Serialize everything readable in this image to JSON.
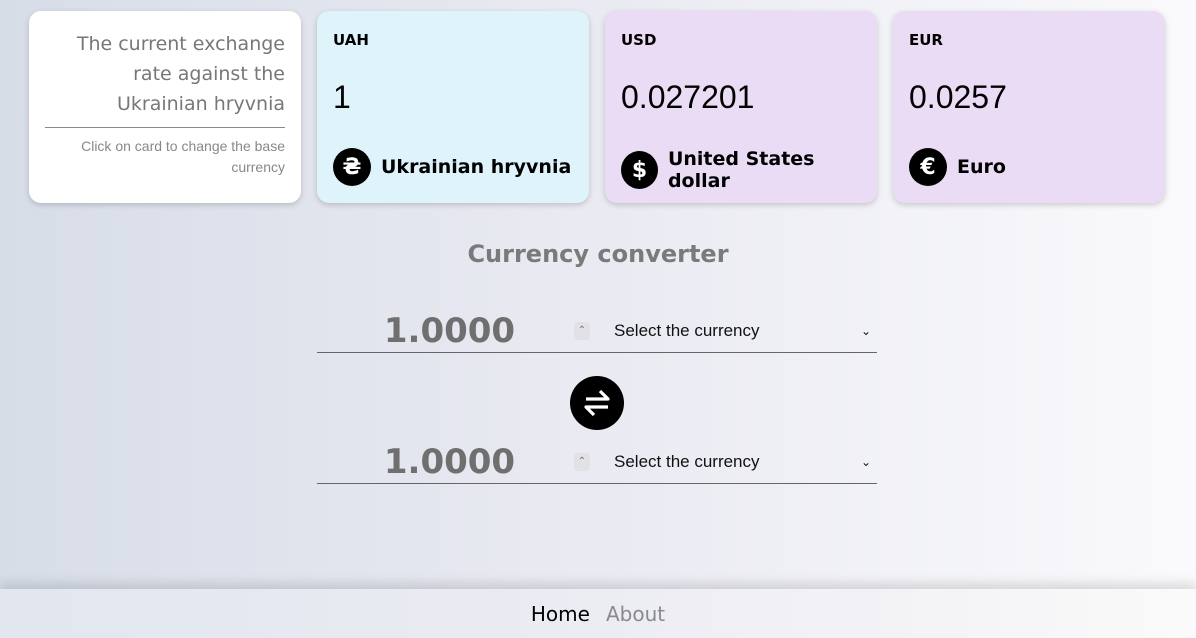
{
  "intro": {
    "title": "The current exchange rate against the Ukrainian hryvnia",
    "hint": "Click on card to change the base currency"
  },
  "cards": [
    {
      "code": "UAH",
      "rate": "1",
      "name": "Ukrainian hryvnia",
      "symbol": "₴",
      "icon": "hryvnia-icon"
    },
    {
      "code": "USD",
      "rate": "0.027201",
      "name": "United States dollar",
      "symbol": "$",
      "icon": "dollar-icon"
    },
    {
      "code": "EUR",
      "rate": "0.0257",
      "name": "Euro",
      "symbol": "€",
      "icon": "euro-icon"
    }
  ],
  "converter": {
    "title": "Currency converter",
    "from": {
      "amount": "1.0000",
      "select_label": "Select the currency"
    },
    "to": {
      "amount": "1.0000",
      "select_label": "Select the currency"
    }
  },
  "footer": {
    "home": "Home",
    "about": "About"
  },
  "colors": {
    "base_card": "#dff3fb",
    "other_card": "#eadcf4"
  }
}
